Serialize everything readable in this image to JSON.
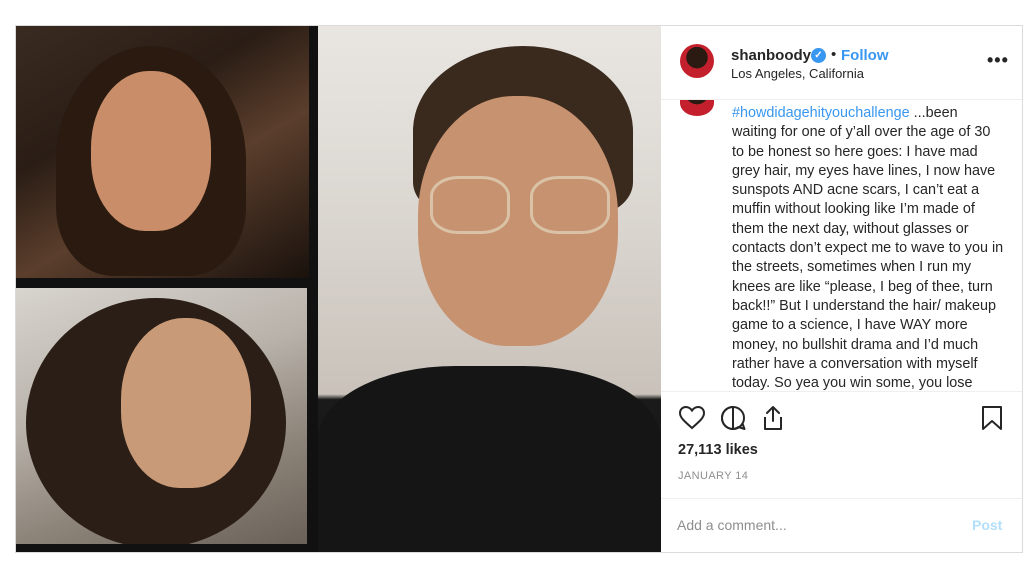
{
  "header": {
    "username": "shanboody",
    "verified_mark": "✓",
    "separator": "•",
    "follow_label": "Follow",
    "location": "Los Angeles, California",
    "more_label": "•••"
  },
  "caption": {
    "hashtag": "#howdidagehityouchallenge",
    "text": " ...been waiting for one of y’all over the age of 30 to be honest so here goes: I have mad grey hair, my eyes have lines, I now have sunspots AND acne scars, I can’t eat a muffin without looking like I’m made of them the next day, without glasses or contacts don’t expect me to wave to you in the streets, sometimes when I run my knees are like “please, I beg of thee, turn back!!” But I understand the hair/ makeup game to a science, I have WAY more money, no bullshit drama and I’d much rather have a conversation with myself today. So yea you win some, you lose some."
  },
  "likes": "27,113 likes",
  "date": "JANUARY 14",
  "comment": {
    "placeholder": "Add a comment...",
    "post_label": "Post"
  },
  "icons": [
    "heart-icon",
    "comment-icon",
    "share-icon",
    "bookmark-icon",
    "verified-badge-icon",
    "more-options-icon"
  ],
  "colors": {
    "link_blue": "#3897f0",
    "post_disabled": "#b2dffc",
    "muted": "#8e8e8e",
    "text": "#262626"
  }
}
